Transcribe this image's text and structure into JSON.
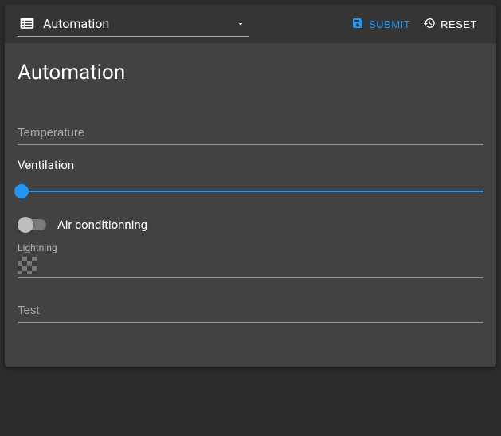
{
  "toolbar": {
    "select_value": "Automation",
    "submit_label": "SUBMIT",
    "reset_label": "RESET"
  },
  "page": {
    "title": "Automation"
  },
  "fields": {
    "temperature": {
      "placeholder": "Temperature",
      "value": ""
    },
    "ventilation": {
      "label": "Ventilation",
      "value": 0
    },
    "air_conditioning": {
      "label": "Air conditionning",
      "value": false
    },
    "lightning": {
      "label": "Lightning",
      "value": null
    },
    "test": {
      "placeholder": "Test",
      "value": ""
    }
  }
}
